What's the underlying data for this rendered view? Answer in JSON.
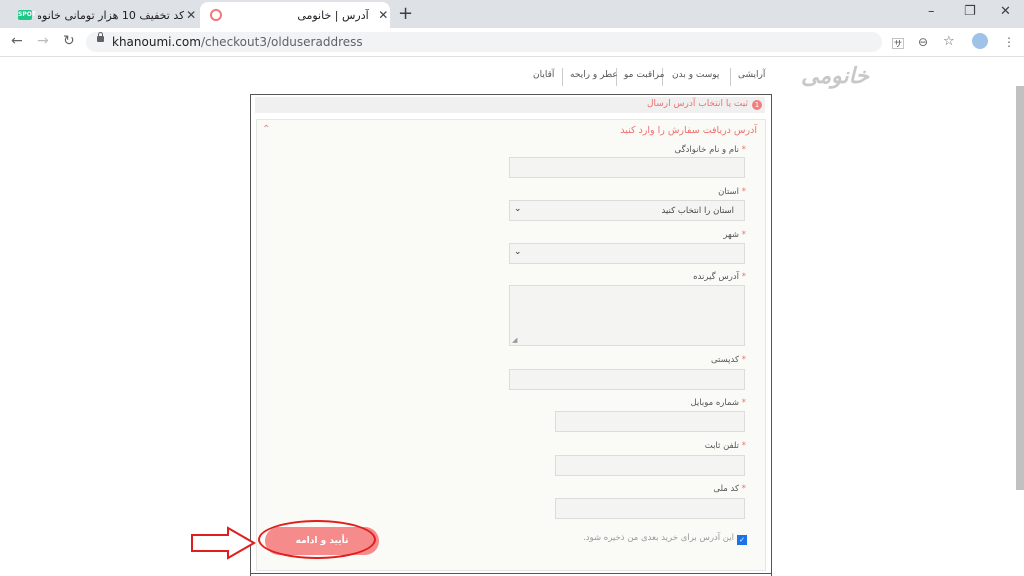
{
  "browser": {
    "tabs": [
      {
        "favicon_label": "SPOT",
        "title": "کد تخفیف 10 هزار تومانی خانومی ر"
      },
      {
        "title": "آدرس | خانومی"
      }
    ],
    "url_host": "khanoumi.com",
    "url_path": "/checkout3/olduseraddress"
  },
  "site": {
    "logo": "خانومی",
    "nav": [
      "آرایشی",
      "پوست و بدن",
      "مراقبت مو",
      "عطر و رایحه",
      "آقایان"
    ]
  },
  "checkout": {
    "step_number": "1",
    "step_title": "ثبت یا انتخاب آدرس ارسال",
    "section_title": "آدرس دریافت سفارش را وارد کنید",
    "fields": {
      "full_name": {
        "label": "نام و نام خانوادگی",
        "value": ""
      },
      "province": {
        "label": "استان",
        "value": "استان را انتخاب کنید"
      },
      "city": {
        "label": "شهر",
        "value": ""
      },
      "address": {
        "label": "آدرس گیرنده",
        "value": ""
      },
      "postal_code": {
        "label": "کدپستی",
        "value": ""
      },
      "mobile": {
        "label": "شماره موبایل",
        "value": ""
      },
      "phone": {
        "label": "تلفن ثابت",
        "value": ""
      },
      "national_id": {
        "label": "کد ملی",
        "value": ""
      }
    },
    "save_address": {
      "checked": true,
      "label": "این آدرس برای خرید بعدی من ذخیره شود."
    },
    "submit_label": "تأیید و ادامه"
  },
  "colors": {
    "accent": "#f06e6e",
    "button": "#f58b8b",
    "annotation": "#e01e1e"
  },
  "icons": [
    "close-icon",
    "plus-icon",
    "back-arrow-icon",
    "forward-arrow-icon",
    "reload-icon",
    "lock-icon",
    "translate-icon",
    "zoom-icon",
    "star-icon",
    "profile-avatar",
    "menu-dots-icon",
    "chevron-up-icon",
    "chevron-down-icon",
    "arrow-right-annotation",
    "ellipse-annotation"
  ]
}
